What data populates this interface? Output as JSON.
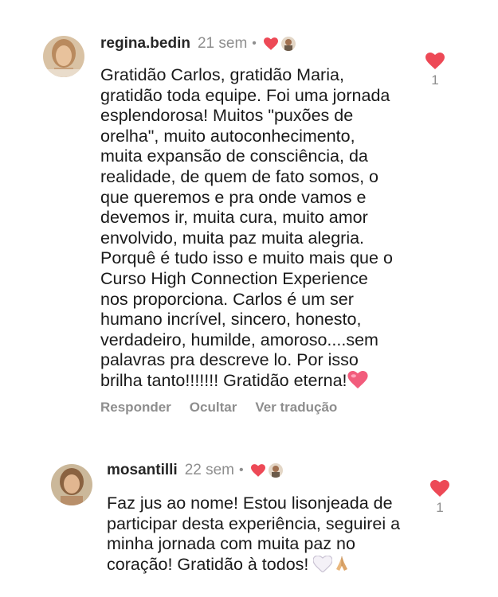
{
  "comments": [
    {
      "username": "regina.bedin",
      "time": "21 sem",
      "dot": "•",
      "text": "Gratidão Carlos, gratidão Maria,\ngratidão toda equipe. Foi uma jornada\nesplendorosa! Muitos \"puxões de\norelha\", muito autoconhecimento,\nmuita expansão de consciência, da\nrealidade, de quem de fato somos, o\nque queremos e pra onde vamos e\ndevemos ir, muita cura, muito amor\nenvolvido, muita paz muita alegria.\nPorquê é tudo isso e muito mais que o\nCurso High Connection Experience\nnos proporciona. Carlos é um ser\nhumano incrível, sincero, honesto,\nverdadeiro, humilde, amoroso....sem\npalavras pra descreve lo. Por isso\nbrilha tanto!!!!!!! Gratidão eterna!",
      "end_emoji": "pink-heart-emoji",
      "likes": "1",
      "actions": {
        "reply": "Responder",
        "hide": "Ocultar",
        "translate": "Ver tradução"
      }
    },
    {
      "username": "mosantilli",
      "time": "22 sem",
      "dot": "•",
      "text": "Faz jus ao nome! Estou lisonjeada de\nparticipar desta experiência, seguirei a\nminha jornada com muita paz no\ncoração! Gratidão à todos!",
      "end_emojis": [
        "white-heart-emoji",
        "praying-hands-emoji"
      ],
      "likes": "1"
    }
  ],
  "colors": {
    "like_red": "#ed4956",
    "muted_gray": "#8e8e8e",
    "text": "#1a1a1a",
    "username": "#262626"
  }
}
